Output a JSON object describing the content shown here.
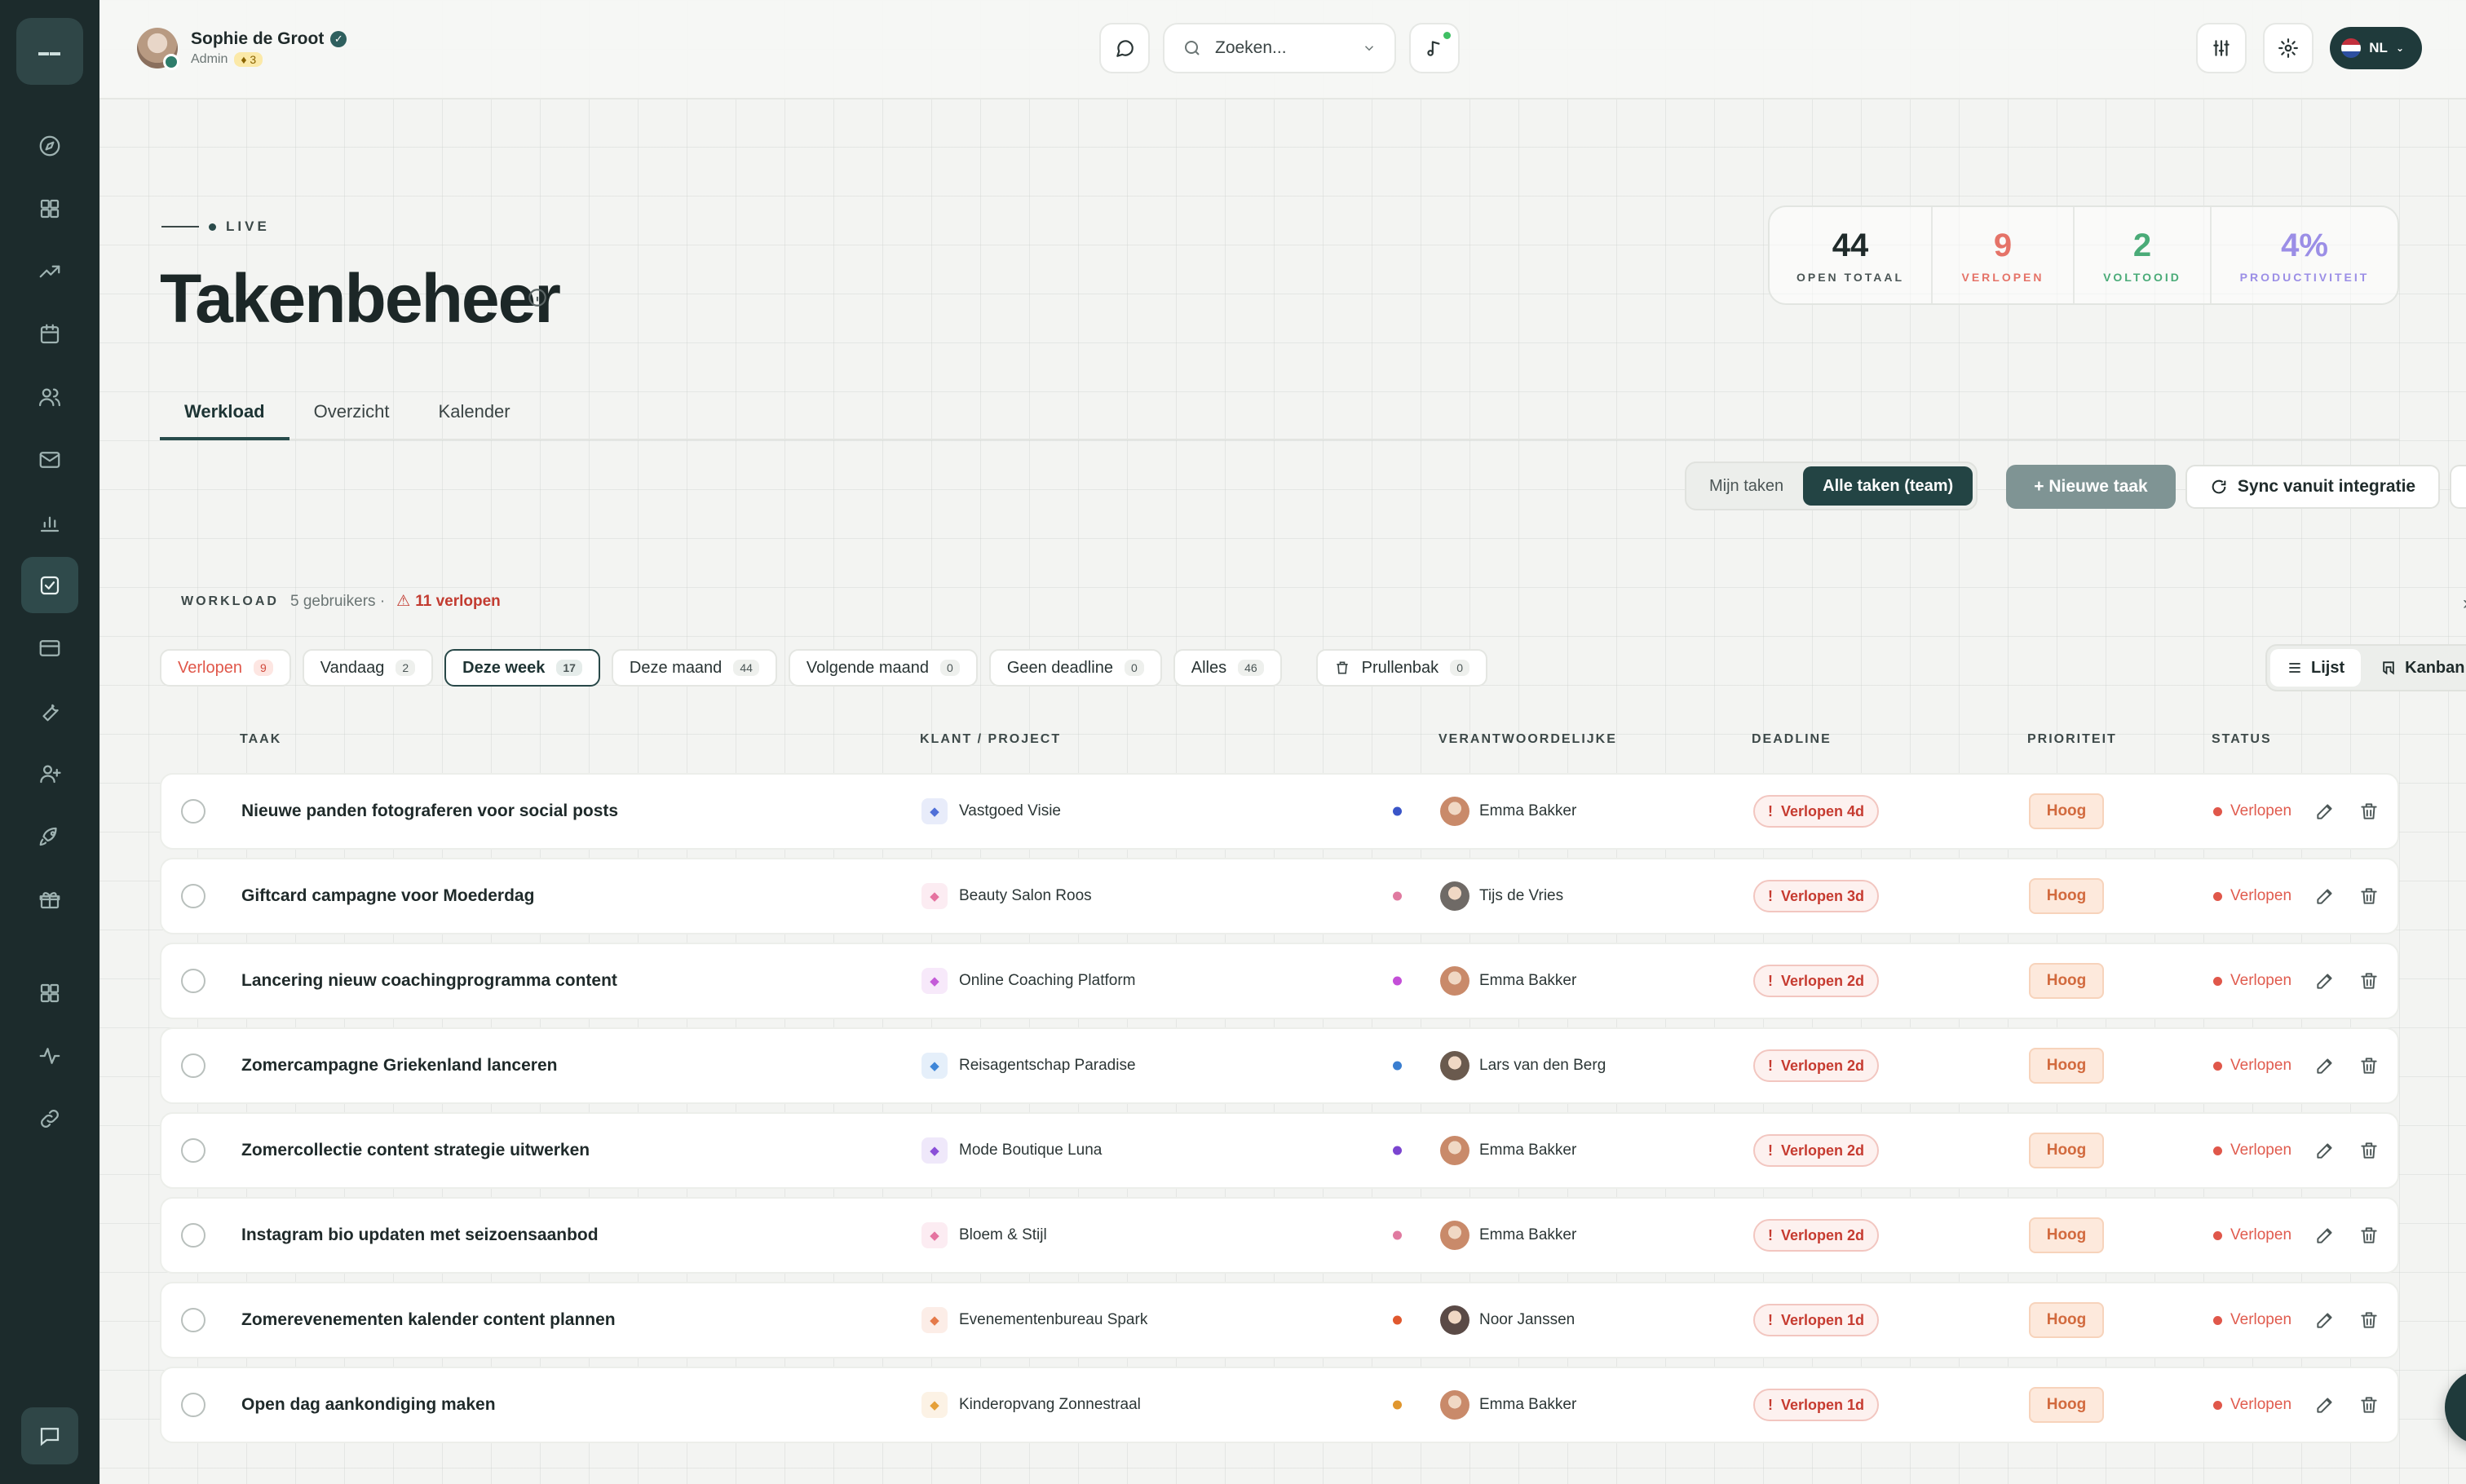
{
  "user": {
    "name": "Sophie de Groot",
    "role": "Admin",
    "xp": "3"
  },
  "search": {
    "placeholder": "Zoeken..."
  },
  "language": "NL",
  "header": {
    "live": "LIVE",
    "title": "Takenbeheer"
  },
  "stats": [
    {
      "value": "44",
      "label": "OPEN TOTAAL",
      "color": "#1f2a2a"
    },
    {
      "value": "9",
      "label": "VERLOPEN",
      "color": "#e57368"
    },
    {
      "value": "2",
      "label": "VOLTOOID",
      "color": "#4aab78"
    },
    {
      "value": "4%",
      "label": "PRODUCTIVITEIT",
      "color": "#9b8ee6"
    }
  ],
  "tabs": [
    "Werkload",
    "Overzicht",
    "Kalender"
  ],
  "actions": {
    "mine": "Mijn taken",
    "all": "Alle taken (team)",
    "new": "+ Nieuwe taak",
    "sync": "Sync vanuit integratie"
  },
  "workload": {
    "label": "WORKLOAD",
    "users": "5 gebruikers ·",
    "overdue": "11 verlopen"
  },
  "filters": [
    {
      "label": "Verlopen",
      "count": "9"
    },
    {
      "label": "Vandaag",
      "count": "2"
    },
    {
      "label": "Deze week",
      "count": "17"
    },
    {
      "label": "Deze maand",
      "count": "44"
    },
    {
      "label": "Volgende maand",
      "count": "0"
    },
    {
      "label": "Geen deadline",
      "count": "0"
    },
    {
      "label": "Alles",
      "count": "46"
    },
    {
      "label": "Prullenbak",
      "count": "0"
    }
  ],
  "views": {
    "list": "Lijst",
    "kanban": "Kanban"
  },
  "columns": {
    "task": "TAAK",
    "client": "KLANT / PROJECT",
    "owner": "VERANTWOORDELIJKE",
    "deadline": "DEADLINE",
    "priority": "PRIORITEIT",
    "status": "STATUS"
  },
  "rows": [
    {
      "task": "Nieuwe panden fotograferen voor social posts",
      "client": "Vastgoed Visie",
      "owner": "Emma Bakker",
      "deadline": "Verlopen 4d",
      "priority": "Hoog",
      "status": "Verlopen",
      "client_color": "#4f6fd8",
      "dot": "#3a55c8",
      "avatar": "#c98a6a"
    },
    {
      "task": "Giftcard campagne voor Moederdag",
      "client": "Beauty Salon Roos",
      "owner": "Tijs de Vries",
      "deadline": "Verlopen 3d",
      "priority": "Hoog",
      "status": "Verlopen",
      "client_color": "#e573a0",
      "dot": "#e07aa0",
      "avatar": "#6f6a66"
    },
    {
      "task": "Lancering nieuw coachingprogramma content",
      "client": "Online Coaching Platform",
      "owner": "Emma Bakker",
      "deadline": "Verlopen 2d",
      "priority": "Hoog",
      "status": "Verlopen",
      "client_color": "#c45bd8",
      "dot": "#c44fd8",
      "avatar": "#c98a6a"
    },
    {
      "task": "Zomercampagne Griekenland lanceren",
      "client": "Reisagentschap Paradise",
      "owner": "Lars van den Berg",
      "deadline": "Verlopen 2d",
      "priority": "Hoog",
      "status": "Verlopen",
      "client_color": "#3f86d8",
      "dot": "#3a7ed0",
      "avatar": "#6a5a4e"
    },
    {
      "task": "Zomercollectie content strategie uitwerken",
      "client": "Mode Boutique Luna",
      "owner": "Emma Bakker",
      "deadline": "Verlopen 2d",
      "priority": "Hoog",
      "status": "Verlopen",
      "client_color": "#8a4fd8",
      "dot": "#7b45d0",
      "avatar": "#c98a6a"
    },
    {
      "task": "Instagram bio updaten met seizoensaanbod",
      "client": "Bloem & Stijl",
      "owner": "Emma Bakker",
      "deadline": "Verlopen 2d",
      "priority": "Hoog",
      "status": "Verlopen",
      "client_color": "#e573a0",
      "dot": "#e07aa0",
      "avatar": "#c98a6a"
    },
    {
      "task": "Zomerevenementen kalender content plannen",
      "client": "Evenementenbureau Spark",
      "owner": "Noor Janssen",
      "deadline": "Verlopen 1d",
      "priority": "Hoog",
      "status": "Verlopen",
      "client_color": "#e57a4a",
      "dot": "#e0582e",
      "avatar": "#5a4a46"
    },
    {
      "task": "Open dag aankondiging maken",
      "client": "Kinderopvang Zonnestraal",
      "owner": "Emma Bakker",
      "deadline": "Verlopen 1d",
      "priority": "Hoog",
      "status": "Verlopen",
      "client_color": "#e5a03a",
      "dot": "#e0962e",
      "avatar": "#c98a6a"
    }
  ]
}
